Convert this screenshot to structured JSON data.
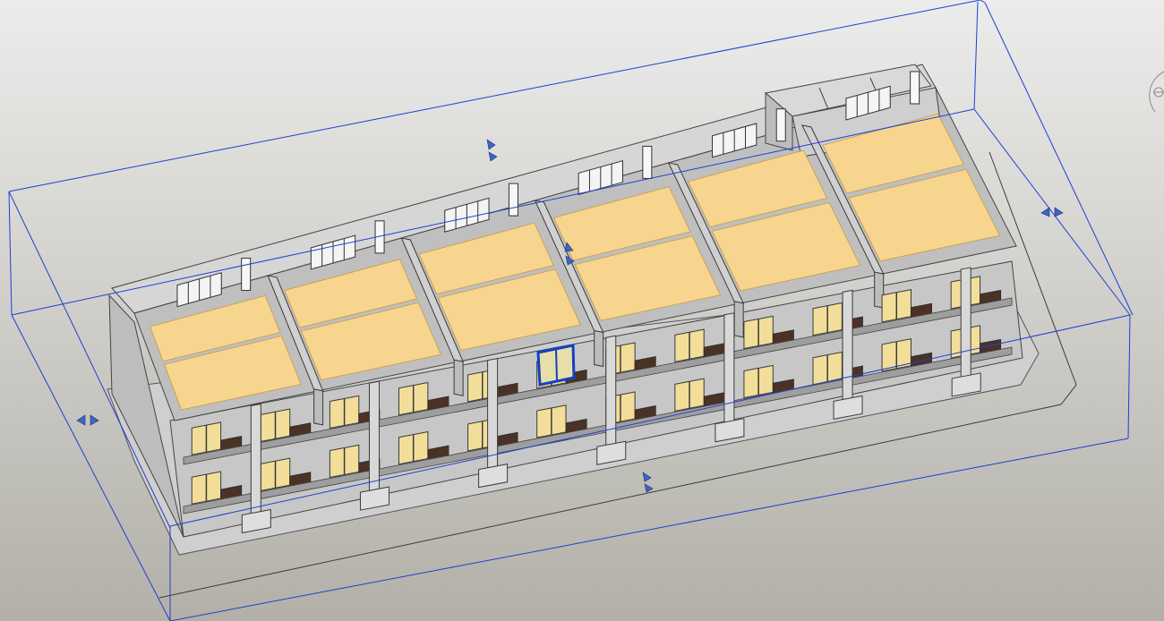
{
  "view": {
    "kind": "3d-model-viewport",
    "subject": "building",
    "colors": {
      "background_top": "#e9e9e5",
      "background_bottom": "#b3b1a8",
      "section_box": "#1f3fd1",
      "selected": "#1240c8",
      "floor": "#f8d58e",
      "floor_edge": "#c9a259",
      "wall": "#d3d3d3",
      "wall_dark": "#a4a4a4",
      "glass": "#f2de99",
      "frame": "#3b3b3b",
      "railing_dark": "#4b3226",
      "edge_line": "#2a2a2a"
    }
  },
  "section_box": {
    "handles": [
      "handle-top",
      "handle-right",
      "handle-left",
      "handle-bottom",
      "handle-center"
    ]
  },
  "viewcube": {
    "icon": "viewcube-orbit-icon"
  }
}
